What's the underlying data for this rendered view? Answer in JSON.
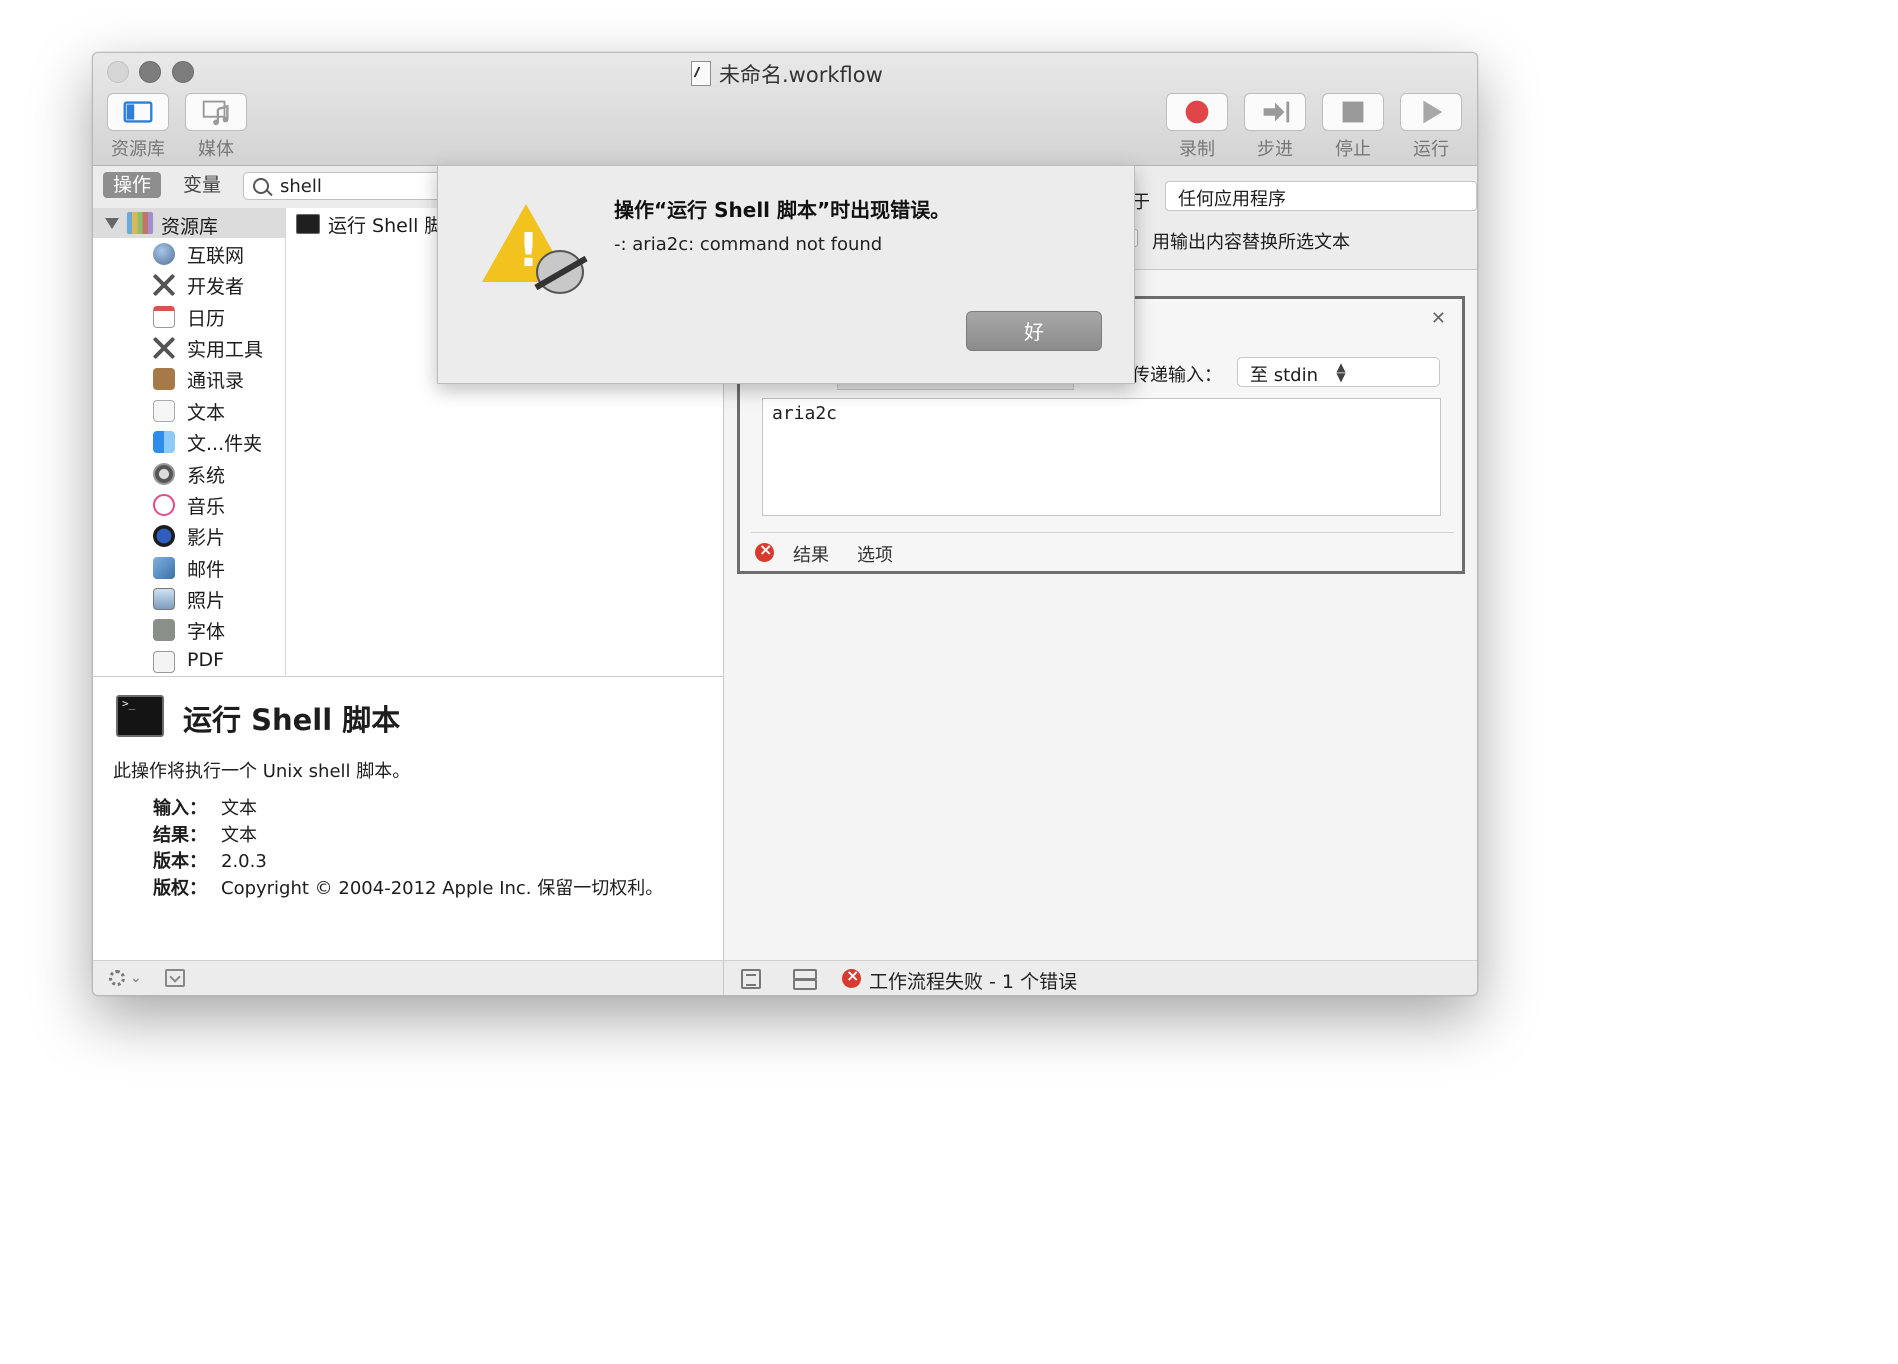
{
  "window": {
    "title": "未命名.workflow"
  },
  "toolbar": {
    "left": [
      {
        "label": "资源库",
        "icon": "sidebar-toggle-icon"
      },
      {
        "label": "媒体",
        "icon": "media-icon"
      }
    ],
    "right": [
      {
        "label": "录制",
        "icon": "record-icon",
        "color": "#e0454a"
      },
      {
        "label": "步进",
        "icon": "step-icon"
      },
      {
        "label": "停止",
        "icon": "stop-icon"
      },
      {
        "label": "运行",
        "icon": "play-icon"
      }
    ]
  },
  "library": {
    "tabs": {
      "actions": "操作",
      "variables": "变量"
    },
    "search": {
      "value": "shell",
      "placeholder": ""
    },
    "root": "资源库",
    "categories": [
      {
        "label": "互联网",
        "icon": "globe-icon"
      },
      {
        "label": "开发者",
        "icon": "tools-icon"
      },
      {
        "label": "日历",
        "icon": "calendar-icon"
      },
      {
        "label": "实用工具",
        "icon": "tools-icon"
      },
      {
        "label": "通讯录",
        "icon": "contacts-icon"
      },
      {
        "label": "文本",
        "icon": "text-icon"
      },
      {
        "label": "文...件夹",
        "icon": "finder-icon"
      },
      {
        "label": "系统",
        "icon": "system-icon"
      },
      {
        "label": "音乐",
        "icon": "music-icon"
      },
      {
        "label": "影片",
        "icon": "movie-icon"
      },
      {
        "label": "邮件",
        "icon": "mail-icon"
      },
      {
        "label": "照片",
        "icon": "photos-icon"
      },
      {
        "label": "字体",
        "icon": "font-icon"
      },
      {
        "label": "PDF",
        "icon": "pdf-icon"
      }
    ],
    "results": [
      {
        "label": "运行 Shell 脚本"
      }
    ]
  },
  "description": {
    "title": "运行 Shell 脚本",
    "text": "此操作将执行一个 Unix shell 脚本。",
    "meta": [
      {
        "key": "输入：",
        "value": "文本"
      },
      {
        "key": "结果：",
        "value": "文本"
      },
      {
        "key": "版本：",
        "value": "2.0.3"
      },
      {
        "key": "版权：",
        "value": "Copyright © 2004-2012 Apple Inc. 保留一切权利。"
      }
    ]
  },
  "workflow": {
    "receives_suffix": "于",
    "application": "任何应用程序",
    "replace_label": "用输出内容替换所选文本",
    "action": {
      "pass_input_label": "传递输入：",
      "pass_input_value": "至 stdin",
      "script": "aria2c",
      "footer_results": "结果",
      "footer_options": "选项"
    }
  },
  "status": {
    "text": "工作流程失败 - 1 个错误",
    "error_color": "#d93a2f"
  },
  "alert": {
    "title": "操作“运行 Shell 脚本”时出现错误。",
    "message": "-: aria2c: command not found",
    "ok_label": "好",
    "icon": "warning-icon"
  }
}
